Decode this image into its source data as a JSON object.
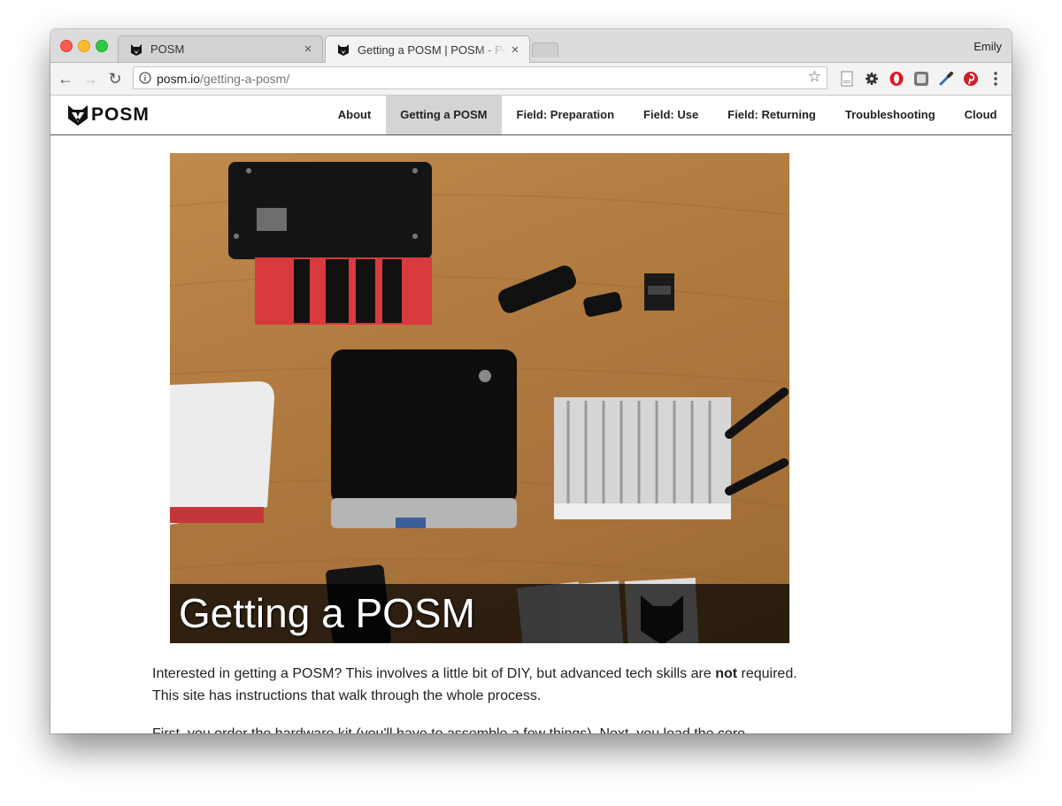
{
  "browser": {
    "tabs": [
      {
        "title": "POSM",
        "close": "×"
      },
      {
        "title": "Getting a POSM | POSM - Portable OpenStreetMap",
        "close": "×"
      }
    ],
    "profile": "Emily",
    "url_host": "posm.io",
    "url_path": "/getting-a-posm/",
    "icons": [
      "back-icon",
      "forward-icon",
      "reload-icon",
      "info-icon",
      "star-icon",
      "reader-icon",
      "gear-icon",
      "opera-icon",
      "ghostery-icon",
      "eyedropper-icon",
      "pinterest-icon",
      "menu-icon"
    ]
  },
  "site": {
    "logo_text": "POSM",
    "nav": [
      {
        "label": "About",
        "active": false
      },
      {
        "label": "Getting a POSM",
        "active": true
      },
      {
        "label": "Field: Preparation",
        "active": false
      },
      {
        "label": "Field: Use",
        "active": false
      },
      {
        "label": "Field: Returning",
        "active": false
      },
      {
        "label": "Troubleshooting",
        "active": false
      },
      {
        "label": "Cloud",
        "active": false
      }
    ]
  },
  "content": {
    "hero_caption": "Getting a POSM",
    "p1_before": "Interested in getting a POSM? This involves a little bit of DIY, but advanced tech skills are ",
    "p1_bold": "not",
    "p1_after": " required. This site has instructions that walk through the whole process.",
    "p2": "First, you order the hardware kit (you'll have to assemble a few things). Next, you load the core"
  },
  "colors": {
    "nav_active_bg": "#d4d4d4",
    "caption_bg": "#000000",
    "sd_card": "#1a1a1a"
  }
}
